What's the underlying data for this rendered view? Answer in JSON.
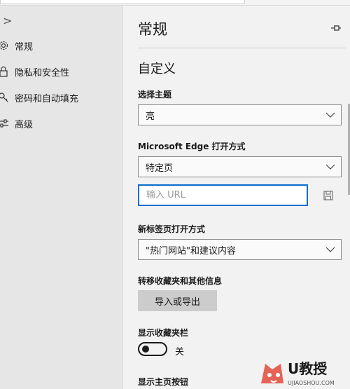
{
  "sidebar": {
    "items": [
      {
        "label": "常规",
        "icon": "gear-icon"
      },
      {
        "label": "隐私和安全性",
        "icon": "lock-icon"
      },
      {
        "label": "密码和自动填充",
        "icon": "key-icon"
      },
      {
        "label": "高级",
        "icon": "sliders-icon"
      }
    ]
  },
  "main": {
    "title": "常规",
    "section_title": "自定义",
    "theme": {
      "label": "选择主题",
      "value": "亮"
    },
    "open_with": {
      "label": "Microsoft Edge 打开方式",
      "value": "特定页"
    },
    "url": {
      "placeholder": "输入 URL",
      "value": ""
    },
    "new_tab": {
      "label": "新标签页打开方式",
      "value": "\"热门网站\"和建议内容"
    },
    "transfer": {
      "label": "转移收藏夹和其他信息",
      "button": "导入或导出"
    },
    "favorites_bar": {
      "label": "显示收藏夹栏",
      "state": "关"
    },
    "home_button": {
      "label": "显示主页按钮"
    }
  },
  "watermark": {
    "text": "U教授",
    "url": "UJIAOSHOU.COM"
  },
  "colors": {
    "accent": "#0a6ecf",
    "sidebar_bg": "#e6e6e6",
    "panel_bg": "#f2f2f2",
    "button_bg": "#cccccc"
  }
}
